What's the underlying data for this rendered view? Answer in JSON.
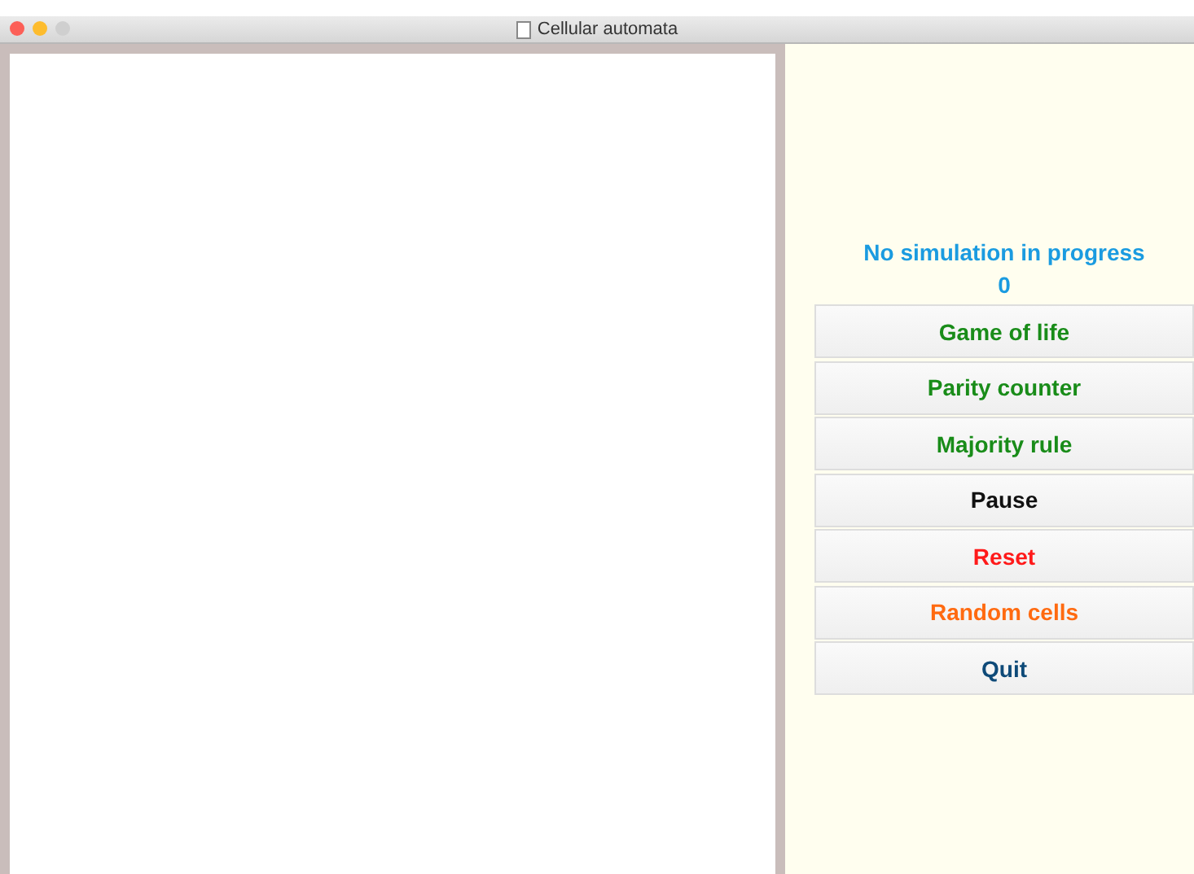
{
  "window": {
    "title": "Cellular automata"
  },
  "status": {
    "message": "No simulation in progress",
    "counter": "0"
  },
  "buttons": [
    {
      "label": "Game of life",
      "color": "#198c19"
    },
    {
      "label": "Parity counter",
      "color": "#198c19"
    },
    {
      "label": "Majority rule",
      "color": "#198c19"
    },
    {
      "label": "Pause",
      "color": "#111111"
    },
    {
      "label": "Reset",
      "color": "#ff1a1a"
    },
    {
      "label": "Random cells",
      "color": "#ff6a10"
    },
    {
      "label": "Quit",
      "color": "#0e4a78"
    }
  ]
}
